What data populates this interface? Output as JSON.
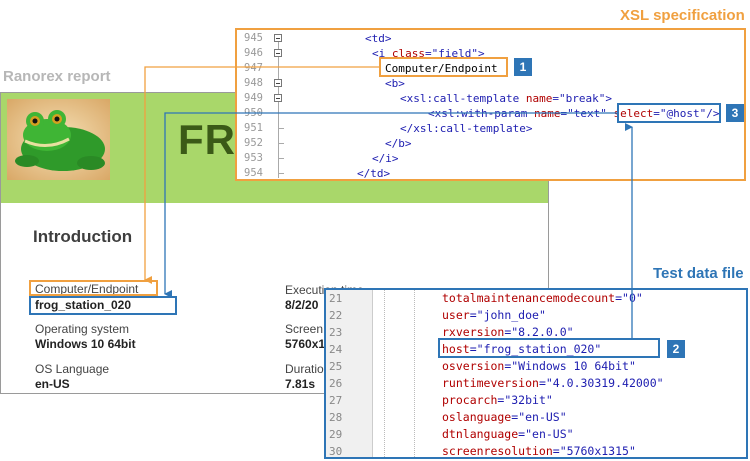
{
  "titles": {
    "xsl": "XSL specification",
    "report": "Ranorex report",
    "testdata": "Test data file"
  },
  "report": {
    "heading": "FRO",
    "intro": "Introduction",
    "fields": [
      {
        "label": "Computer/Endpoint",
        "value": "frog_station_020"
      },
      {
        "label": "Operating system",
        "value": "Windows 10 64bit"
      },
      {
        "label": "OS Language",
        "value": "en-US"
      }
    ],
    "right_fields": [
      {
        "label": "Execution time",
        "value": "8/2/20"
      },
      {
        "label": "Screen",
        "value": "5760x1"
      },
      {
        "label": "Duratio",
        "value": "7.81s"
      }
    ]
  },
  "xsl": {
    "line_numbers": [
      "945",
      "946",
      "947",
      "948",
      "949",
      "950",
      "951",
      "952",
      "953",
      "954"
    ],
    "lines": {
      "l945_tag": "<td>",
      "l946_open": "<i ",
      "l946_attr": "class",
      "l946_eq": "=",
      "l946_str": "\"field\"",
      "l946_close": ">",
      "l947_text": "Computer/Endpoint",
      "l948_tag": "<b>",
      "l949_open": "<xsl:call-template ",
      "l949_attr": "name",
      "l949_eq": "=",
      "l949_str": "\"break\"",
      "l949_close": ">",
      "l950_open": "<xsl:with-param ",
      "l950_attr": "name",
      "l950_eq": "=",
      "l950_str": "\"text\"",
      "l950_sel_attr": "select",
      "l950_sel_eq": "=",
      "l950_sel_str": "\"@host\"",
      "l950_close": "/>",
      "l951_tag": "</xsl:call-template>",
      "l952_tag": "</b>",
      "l953_tag": "</i>",
      "l954_tag": "</td>"
    }
  },
  "testdata": {
    "line_numbers": [
      "21",
      "22",
      "23",
      "24",
      "25",
      "26",
      "27",
      "28",
      "29",
      "30"
    ],
    "entries": [
      {
        "key": "totalmaintenancemodecount",
        "value": "\"0\""
      },
      {
        "key": "user",
        "value": "\"john_doe\""
      },
      {
        "key": "rxversion",
        "value": "\"8.2.0.0\""
      },
      {
        "key": "host",
        "value": "\"frog_station_020\""
      },
      {
        "key": "osversion",
        "value": "\"Windows 10 64bit\""
      },
      {
        "key": "runtimeversion",
        "value": "\"4.0.30319.42000\""
      },
      {
        "key": "procarch",
        "value": "\"32bit\""
      },
      {
        "key": "oslanguage",
        "value": "\"en-US\""
      },
      {
        "key": "dtnlanguage",
        "value": "\"en-US\""
      },
      {
        "key": "screenresolution",
        "value": "\"5760x1315\""
      }
    ]
  },
  "badges": [
    "1",
    "2",
    "3"
  ],
  "colors": {
    "orange": "#f0a040",
    "blue": "#2e75b6",
    "green_band": "#a9d76a",
    "tag_blue": "#1d1db0",
    "attr_red": "#b00000"
  }
}
